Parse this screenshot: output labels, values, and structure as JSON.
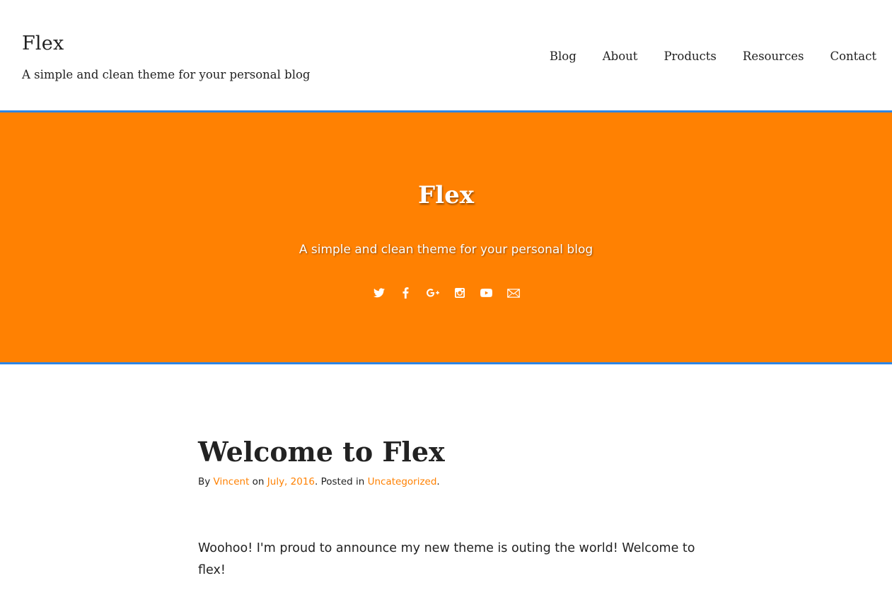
{
  "header": {
    "site_title": "Flex",
    "tagline": "A simple and clean theme for your personal blog",
    "nav": [
      {
        "label": "Blog"
      },
      {
        "label": "About"
      },
      {
        "label": "Products"
      },
      {
        "label": "Resources"
      },
      {
        "label": "Contact"
      }
    ]
  },
  "hero": {
    "title": "Flex",
    "tagline": "A simple and clean theme for your personal blog",
    "background_color": "#ff8102",
    "border_color": "#2f86e5",
    "social_icons": [
      "twitter-icon",
      "facebook-icon",
      "google-plus-icon",
      "instagram-icon",
      "youtube-icon",
      "email-icon"
    ]
  },
  "post": {
    "title": "Welcome to Flex",
    "meta": {
      "by": "By ",
      "author": "Vincent",
      "on": " on ",
      "date": "July, 2016",
      "posted_in": ". Posted in ",
      "category": "Uncategorized",
      "end": "."
    },
    "body": "Woohoo! I'm proud to announce my new theme is outing the world! Welcome to flex!",
    "link_color": "#ff8102"
  }
}
